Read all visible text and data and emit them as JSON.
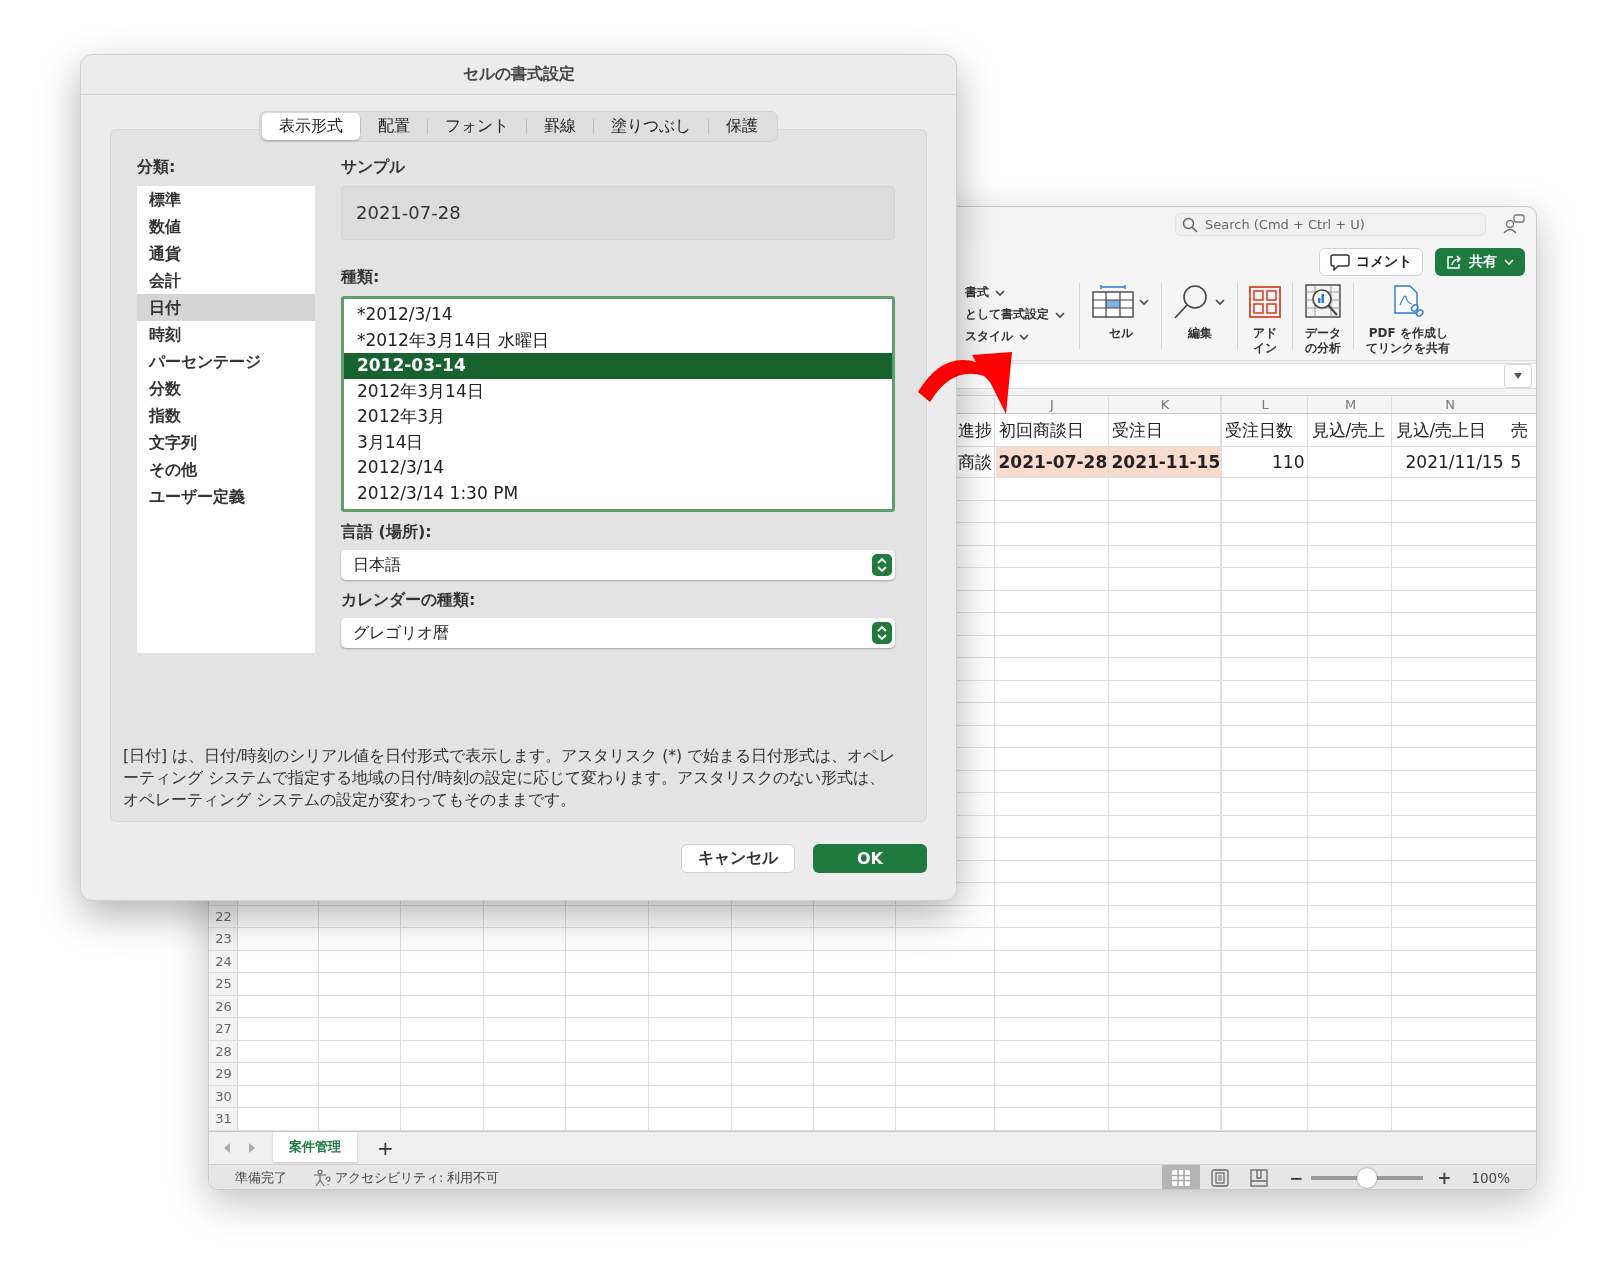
{
  "excel_window": {
    "search": {
      "placeholder": "Search (Cmd + Ctrl + U)"
    },
    "header_buttons": [
      {
        "kind": "comment",
        "label": "コメント"
      },
      {
        "kind": "share",
        "label": "共有"
      }
    ],
    "ribbon": {
      "style_commands": [
        "書式",
        "として書式設定",
        "スタイル"
      ],
      "groups": [
        {
          "kind": "cells",
          "label": "セル"
        },
        {
          "kind": "editing",
          "label": "編集"
        },
        {
          "kind": "addins",
          "label": "アドイン"
        },
        {
          "kind": "analysis",
          "label": "データの分析"
        },
        {
          "kind": "pdf",
          "label": "PDF を作成してリンクを共有"
        }
      ]
    },
    "sheet": {
      "column_headers": [
        "J",
        "K",
        "L",
        "M",
        "N"
      ],
      "rows": [
        {
          "kind": "header",
          "cells": [
            {
              "text": "進捗",
              "highlight": false
            },
            {
              "text": "初回商談日",
              "highlight": false
            },
            {
              "text": "受注日",
              "highlight": false
            },
            {
              "text": "受注日数",
              "highlight": false
            },
            {
              "text": "見込/売上",
              "highlight": false
            },
            {
              "text": "見込/売上日",
              "highlight": false
            },
            {
              "text": "売",
              "highlight": false
            }
          ]
        },
        {
          "kind": "data",
          "cells": [
            {
              "text": "商談",
              "highlight": false
            },
            {
              "text": "2021-07-28",
              "highlight": true
            },
            {
              "text": "2021-11-15",
              "highlight": true
            },
            {
              "text": "110",
              "highlight": false
            },
            {
              "text": "",
              "highlight": false
            },
            {
              "text": "2021/11/15",
              "highlight": false
            },
            {
              "text": "5",
              "highlight": false
            }
          ]
        }
      ],
      "row_numbers": [
        "22",
        "23",
        "24",
        "25",
        "26",
        "27",
        "28",
        "29",
        "30",
        "31"
      ]
    },
    "sheet_tabs": [
      {
        "label": "案件管理",
        "selected": true
      }
    ],
    "add_sheet": "+",
    "status_bar": {
      "ready": "準備完了",
      "accessibility": "アクセシビリティ: 利用不可",
      "views": [
        {
          "kind": "normal",
          "selected": true
        },
        {
          "kind": "page_layout",
          "selected": false
        },
        {
          "kind": "page_break",
          "selected": false
        }
      ],
      "zoom": {
        "minus": "−",
        "plus": "+",
        "level": 0.5,
        "reading": "100%"
      }
    }
  },
  "dialog": {
    "title": "セルの書式設定",
    "tabs": [
      {
        "label": "表示形式",
        "selected": true
      },
      {
        "label": "配置",
        "selected": false
      },
      {
        "label": "フォント",
        "selected": false
      },
      {
        "label": "罫線",
        "selected": false
      },
      {
        "label": "塗りつぶし",
        "selected": false
      },
      {
        "label": "保護",
        "selected": false
      }
    ],
    "category_label": "分類:",
    "categories": [
      {
        "label": "標準",
        "selected": false
      },
      {
        "label": "数値",
        "selected": false
      },
      {
        "label": "通貨",
        "selected": false
      },
      {
        "label": "会計",
        "selected": false
      },
      {
        "label": "日付",
        "selected": true
      },
      {
        "label": "時刻",
        "selected": false
      },
      {
        "label": "パーセンテージ",
        "selected": false
      },
      {
        "label": "分数",
        "selected": false
      },
      {
        "label": "指数",
        "selected": false
      },
      {
        "label": "文字列",
        "selected": false
      },
      {
        "label": "その他",
        "selected": false
      },
      {
        "label": "ユーザー定義",
        "selected": false
      }
    ],
    "sample_label": "サンプル",
    "sample": "2021-07-28",
    "type_label": "種類:",
    "types": [
      {
        "label": "*2012/3/14",
        "selected": false
      },
      {
        "label": "*2012年3月14日 水曜日",
        "selected": false
      },
      {
        "label": "2012-03-14",
        "selected": true
      },
      {
        "label": "2012年3月14日",
        "selected": false
      },
      {
        "label": "2012年3月",
        "selected": false
      },
      {
        "label": "3月14日",
        "selected": false
      },
      {
        "label": "2012/3/14",
        "selected": false
      },
      {
        "label": "2012/3/14 1:30 PM",
        "selected": false
      }
    ],
    "locale_label": "言語 (場所):",
    "locale": "日本語",
    "calendar_label": "カレンダーの種類:",
    "calendar": "グレゴリオ暦",
    "description": "[日付] は、日付/時刻のシリアル値を日付形式で表示します。アスタリスク (*) で始まる日付形式は、オペレーティング システムで指定する地域の日付/時刻の設定に応じて変わります。アスタリスクのない形式は、オペレーティング システムの設定が変わってもそのままです。",
    "buttons": [
      {
        "kind": "cancel",
        "label": "キャンセル"
      },
      {
        "kind": "ok",
        "label": "OK"
      }
    ]
  }
}
